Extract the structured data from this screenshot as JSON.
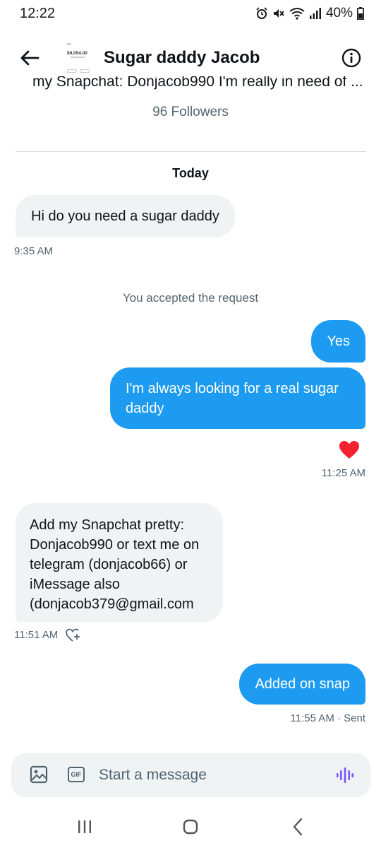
{
  "status_bar": {
    "time": "12:22",
    "battery": "40%"
  },
  "header": {
    "title": "Sugar daddy Jacob",
    "avatar_small_text": "rrs",
    "avatar_amount": "$9,054.00"
  },
  "profile": {
    "bio_snippet": "my Snapchat: Donjacob990 I'm really in need of ...",
    "followers": "96 Followers"
  },
  "conversation": {
    "day_label": "Today",
    "system_message": "You accepted the request",
    "messages": [
      {
        "direction": "in",
        "text": "Hi do you need a sugar daddy",
        "time": "9:35 AM"
      },
      {
        "direction": "out",
        "text": "Yes"
      },
      {
        "direction": "out",
        "text": "I'm always looking for a real sugar daddy",
        "time": "11:25 AM",
        "reaction": "heart"
      },
      {
        "direction": "in",
        "text": "Add my Snapchat pretty: Donjacob990 or text me on telegram (donjacob66) or iMessage also (donjacob379@gmail.com",
        "time": "11:51 AM"
      },
      {
        "direction": "out",
        "text": "Added on snap",
        "time": "11:55 AM · Sent"
      }
    ]
  },
  "composer": {
    "placeholder": "Start a message",
    "gif_label": "GIF"
  },
  "colors": {
    "accent": "#1d9bf0",
    "incoming_bubble": "#eff3f4",
    "secondary_text": "#536471",
    "heart": "#f4212e",
    "voice_icon": "#7856ff"
  },
  "icons": {
    "back": "arrow-left-icon",
    "info": "info-circle-icon",
    "media": "image-icon",
    "gif": "gif-icon",
    "voice": "voice-wave-icon",
    "reaction": "heart-plus-icon"
  }
}
